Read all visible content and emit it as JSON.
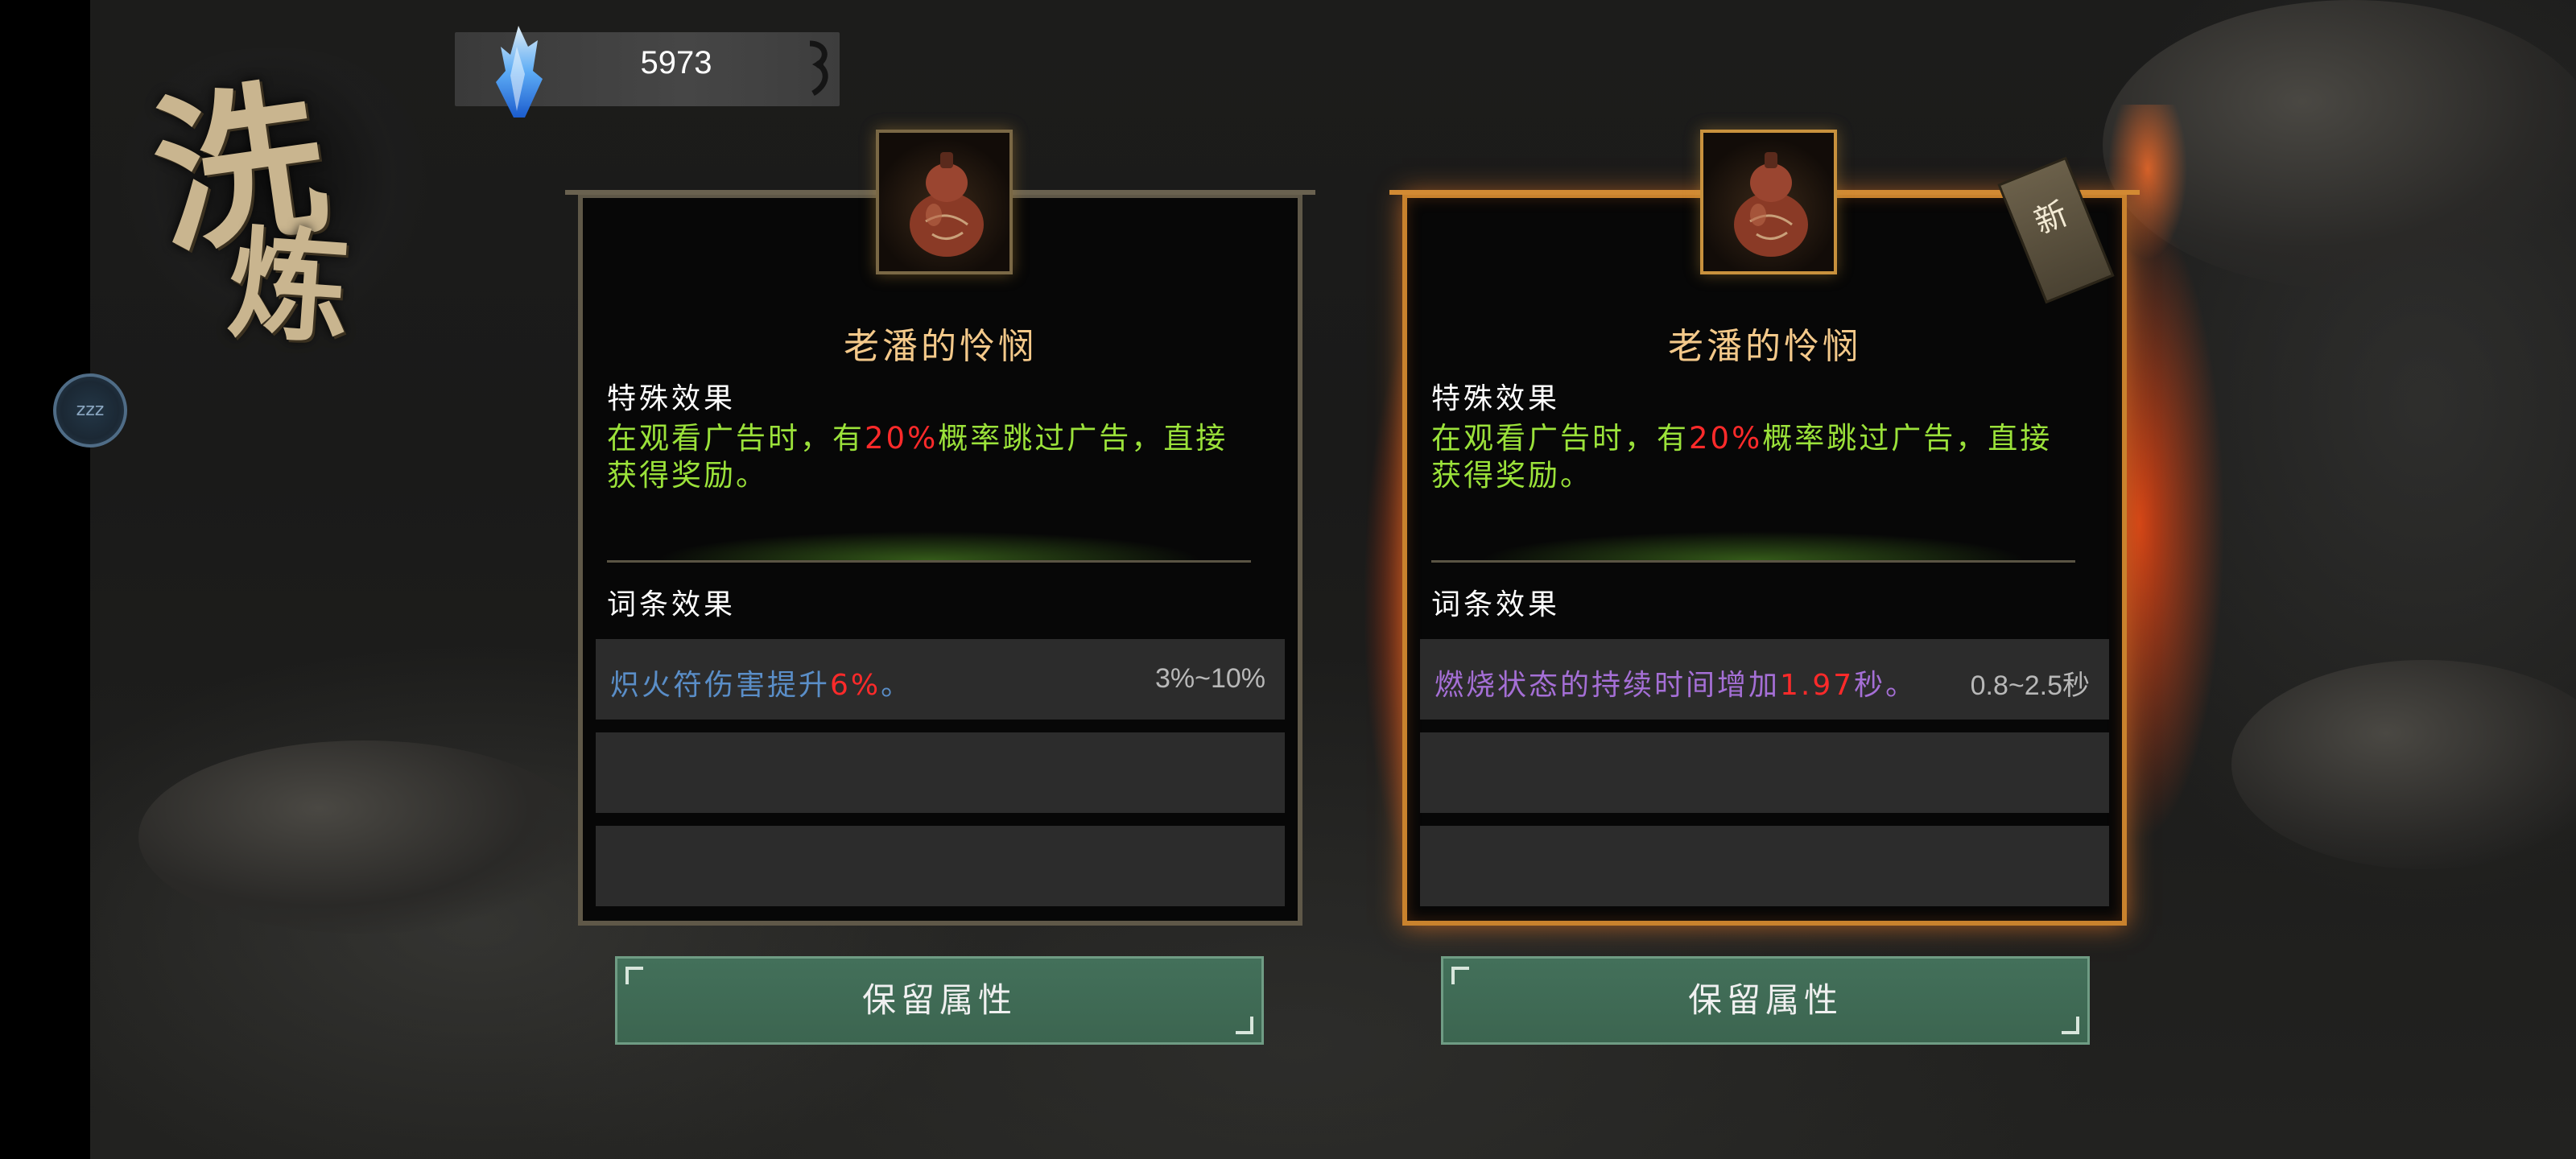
{
  "title": {
    "char1": "洗",
    "char2": "炼"
  },
  "currency": {
    "value": "5973",
    "icon": "blue-crystal-icon"
  },
  "sleep_button": {
    "label": "zzz"
  },
  "cards": [
    {
      "item_name": "老潘的怜悯",
      "item_icon": "gourd-icon",
      "special_title": "特殊效果",
      "special_before": "在观看广告时，有",
      "special_highlight": "20%",
      "special_after": "概率跳过广告，直接获得奖励。",
      "affix_title": "词条效果",
      "affix_before": "炽火符伤害提升",
      "affix_highlight": "6%",
      "affix_after": "。",
      "affix_range": "3%~10%",
      "affix_color": "#5a8ec8",
      "keep_label": "保留属性"
    },
    {
      "item_name": "老潘的怜悯",
      "item_icon": "gourd-icon",
      "new_tag": "新",
      "special_title": "特殊效果",
      "special_before": "在观看广告时，有",
      "special_highlight": "20%",
      "special_after": "概率跳过广告，直接获得奖励。",
      "affix_title": "词条效果",
      "affix_before": "燃烧状态的持续时间增加",
      "affix_highlight": "1.97",
      "affix_after": "秒。",
      "affix_range": "0.8~2.5秒",
      "affix_color": "#a56fd6",
      "keep_label": "保留属性"
    }
  ],
  "colors": {
    "special_text": "#9be23a",
    "highlight": "#ff2a2a",
    "selected_border": "#c9822d",
    "button": "#43705a"
  }
}
